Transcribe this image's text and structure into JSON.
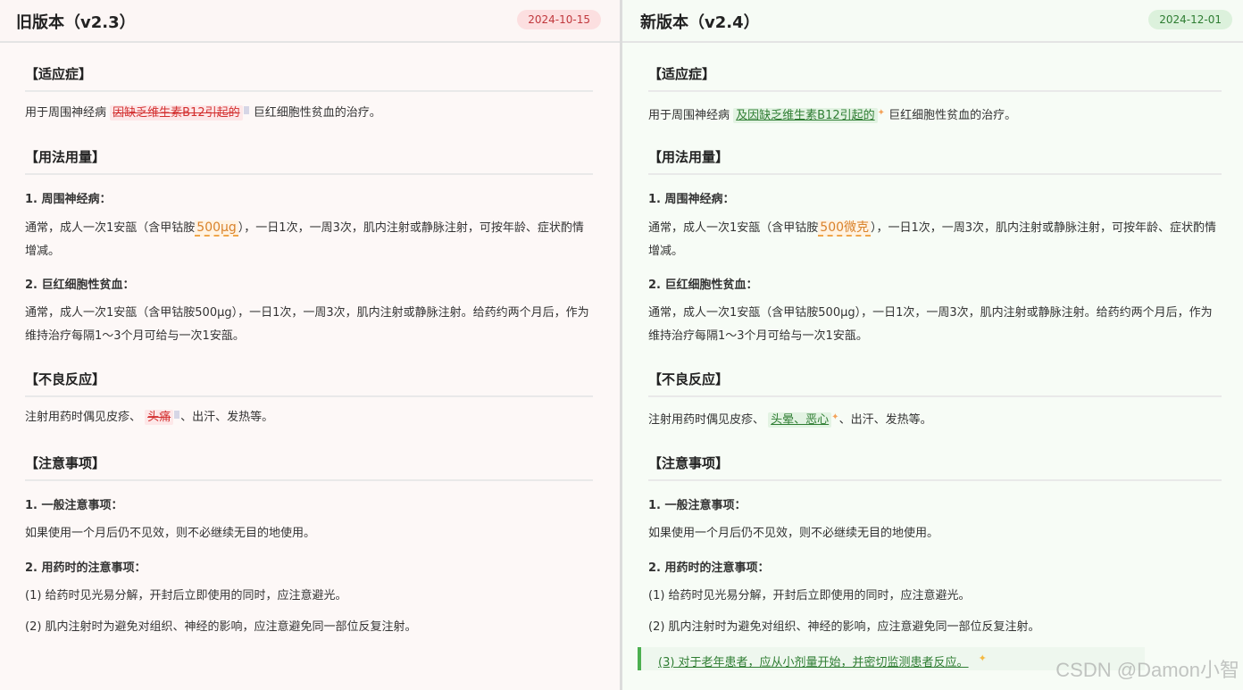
{
  "old": {
    "title": "旧版本（v2.3）",
    "date": "2024-10-15",
    "s1_title": "【适应症】",
    "s1_pre": "用于周围神经病",
    "s1_deleted": "因缺乏维生素B12引起的",
    "s1_post": "巨红细胞性贫血的治疗。",
    "s2_title": "【用法用量】",
    "s2_sub1": "1. 周围神经病：",
    "s2_p1_pre": "通常，成人一次1安瓿（含甲钴胺",
    "s2_p1_dose": "500μg",
    "s2_p1_post": "），一日1次，一周3次，肌内注射或静脉注射，可按年龄、症状酌情增减。",
    "s2_sub2": "2. 巨红细胞性贫血：",
    "s2_p2": "通常，成人一次1安瓿（含甲钴胺500μg），一日1次，一周3次，肌内注射或静脉注射。给药约两个月后，作为维持治疗每隔1～3个月可给与一次1安瓿。",
    "s3_title": "【不良反应】",
    "s3_pre": "注射用药时偶见皮疹、",
    "s3_deleted": "头痛",
    "s3_post": "、出汗、发热等。",
    "s4_title": "【注意事项】",
    "s4_sub1": "1. 一般注意事项：",
    "s4_p1": "如果使用一个月后仍不见效，则不必继续无目的地使用。",
    "s4_sub2": "2. 用药时的注意事项：",
    "s4_p2": "(1) 给药时见光易分解，开封后立即使用的同时，应注意避光。",
    "s4_p3": "(2) 肌内注射时为避免对组织、神经的影响，应注意避免同一部位反复注射。"
  },
  "new": {
    "title": "新版本（v2.4）",
    "date": "2024-12-01",
    "s1_title": "【适应症】",
    "s1_pre": "用于周围神经病",
    "s1_inserted": "及因缺乏维生素B12引起的",
    "s1_post": "巨红细胞性贫血的治疗。",
    "s2_title": "【用法用量】",
    "s2_sub1": "1. 周围神经病：",
    "s2_p1_pre": "通常，成人一次1安瓿（含甲钴胺",
    "s2_p1_dose": "500微克",
    "s2_p1_post": "），一日1次，一周3次，肌内注射或静脉注射，可按年龄、症状酌情增减。",
    "s2_sub2": "2. 巨红细胞性贫血：",
    "s2_p2": "通常，成人一次1安瓿（含甲钴胺500μg），一日1次，一周3次，肌内注射或静脉注射。给药约两个月后，作为维持治疗每隔1～3个月可给与一次1安瓿。",
    "s3_title": "【不良反应】",
    "s3_pre": "注射用药时偶见皮疹、",
    "s3_inserted": "头晕、恶心",
    "s3_post": "、出汗、发热等。",
    "s4_title": "【注意事项】",
    "s4_sub1": "1. 一般注意事项：",
    "s4_p1": "如果使用一个月后仍不见效，则不必继续无目的地使用。",
    "s4_sub2": "2. 用药时的注意事项：",
    "s4_p2": "(1) 给药时见光易分解，开封后立即使用的同时，应注意避光。",
    "s4_p3": "(2) 肌内注射时为避免对组织、神经的影响，应注意避免同一部位反复注射。",
    "s4_p4_added": "(3) 对于老年患者，应从小剂量开始，并密切监测患者反应。"
  },
  "watermark": "CSDN @Damon小智",
  "colors": {
    "deleted": "#d32f2f",
    "inserted": "#2e7d32",
    "modified": "#d9822b",
    "added_bar": "#4caf50"
  },
  "icons": [
    "sparkle-icon"
  ]
}
